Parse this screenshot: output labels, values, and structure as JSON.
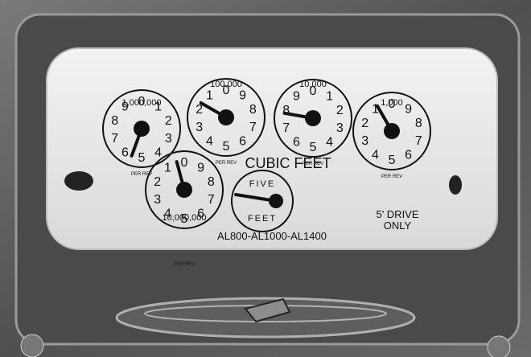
{
  "meter": {
    "title": "CUBIC FEET",
    "model": "AL800-AL1000-AL1400",
    "drive_line1": "5' DRIVE",
    "drive_line2": "ONLY",
    "per_rev": "PER REV",
    "dials": [
      {
        "label": "1,000,000",
        "digits": [
          "0",
          "1",
          "2",
          "3",
          "4",
          "5",
          "6",
          "7",
          "8",
          "9"
        ]
      },
      {
        "label": "100,000",
        "digits": [
          "0",
          "9",
          "8",
          "7",
          "6",
          "5",
          "4",
          "3",
          "2",
          "1"
        ]
      },
      {
        "label": "10,000",
        "digits": [
          "0",
          "1",
          "2",
          "3",
          "4",
          "5",
          "6",
          "7",
          "8",
          "9"
        ]
      },
      {
        "label": "1,000",
        "digits": [
          "0",
          "9",
          "8",
          "7",
          "6",
          "5",
          "4",
          "3",
          "2",
          "1"
        ]
      },
      {
        "label": "10,000,000",
        "digits": [
          "0",
          "9",
          "8",
          "7",
          "6",
          "5",
          "4",
          "3",
          "2",
          "1"
        ]
      }
    ],
    "test_dial": {
      "top": "FIVE",
      "bottom": "FEET"
    }
  },
  "colors": {
    "face": "#ededed",
    "frame": "#5a5a5a",
    "dark": "#151515"
  }
}
